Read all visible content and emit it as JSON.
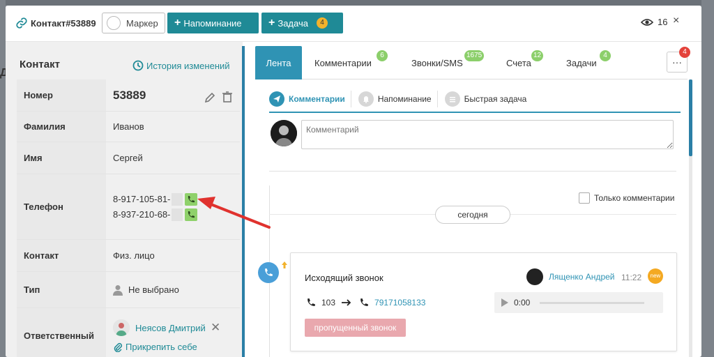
{
  "header": {
    "title": "Контакт#53889",
    "marker_label": "Маркер",
    "remind_label": "Напоминание",
    "task_label": "Задача",
    "task_badge": "4",
    "views_count": "16",
    "close_glyph": "×"
  },
  "background": {
    "left_letter": "Д"
  },
  "contact_panel": {
    "heading": "Контакт",
    "history_label": "История изменений",
    "rows": {
      "number": {
        "label": "Номер",
        "value": "53889"
      },
      "surname": {
        "label": "Фамилия",
        "value": "Иванов"
      },
      "name": {
        "label": "Имя",
        "value": "Сергей"
      },
      "phone": {
        "label": "Телефон",
        "values": [
          "8-917-105-81-",
          "8-937-210-68-"
        ]
      },
      "contact": {
        "label": "Контакт",
        "value": "Физ. лицо"
      },
      "type": {
        "label": "Тип",
        "value": "Не выбрано"
      },
      "responsible": {
        "label": "Ответственный",
        "value": "Неясов Дмитрий",
        "attach_label": "Прикрепить себе"
      }
    }
  },
  "tabs": [
    {
      "label": "Лента",
      "badge": ""
    },
    {
      "label": "Комментарии",
      "badge": "6"
    },
    {
      "label": "Звонки/SMS",
      "badge": "1675"
    },
    {
      "label": "Счета",
      "badge": "12"
    },
    {
      "label": "Задачи",
      "badge": "4"
    }
  ],
  "more": {
    "glyph": "···",
    "badge": "4"
  },
  "subtabs": [
    {
      "label": "Комментарии"
    },
    {
      "label": "Напоминание"
    },
    {
      "label": "Быстрая задача"
    }
  ],
  "comment": {
    "placeholder": "Комментарий"
  },
  "filter": {
    "only_comments_label": "Только комментарии"
  },
  "feed": {
    "date_label": "сегодня",
    "event": {
      "title": "Исходящий звонок",
      "author": "Лященко Андрей",
      "time": "11:22",
      "new_label": "new",
      "from_ext": "103",
      "to_number": "79171058133",
      "player_time": "0:00",
      "status": "пропущенный звонок"
    }
  },
  "colors": {
    "accent": "#1f8a96",
    "tab_active": "#2f93b4",
    "badge_green": "#8ccf6b",
    "badge_red": "#e4423b",
    "missed": "#e9a8ae",
    "arrow": "#e0322e"
  }
}
